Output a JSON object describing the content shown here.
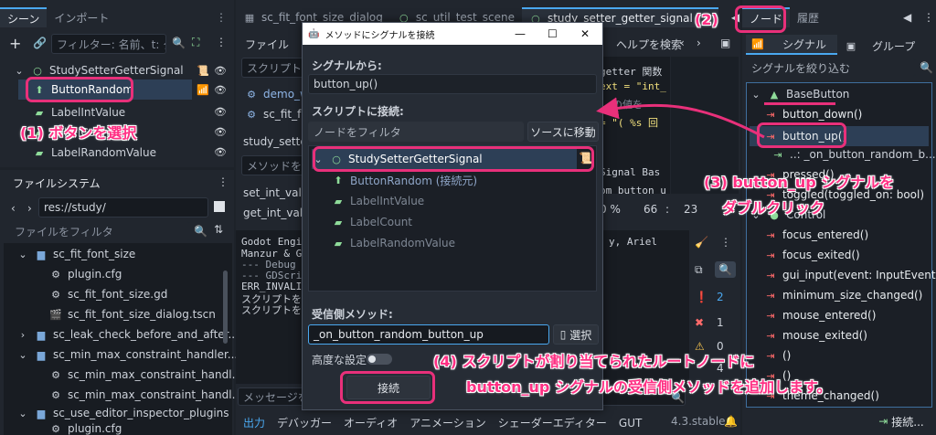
{
  "scene_dock": {
    "tabs": [
      "シーン",
      "インポート"
    ],
    "filter_placeholder": "フィルター: 名前、t: タ",
    "nodes": [
      {
        "label": "StudySetterGetterSignal"
      },
      {
        "label": "ButtonRandom"
      },
      {
        "label": "LabelIntValue"
      },
      {
        "label": "LabelCount"
      },
      {
        "label": "LabelRandomValue"
      }
    ]
  },
  "filesystem": {
    "title": "ファイルシステム",
    "path": "res://study/",
    "filter_placeholder": "ファイルをフィルタ",
    "items": [
      {
        "label": "sc_fit_font_size",
        "icon": "folder-icon"
      },
      {
        "label": "plugin.cfg",
        "icon": "gear-icon"
      },
      {
        "label": "sc_fit_font_size.gd",
        "icon": "gear-icon"
      },
      {
        "label": "sc_fit_font_size_dialog.tscn",
        "icon": "scene-icon"
      },
      {
        "label": "sc_leak_check_before_and_after...",
        "icon": "folder-icon"
      },
      {
        "label": "sc_min_max_constraint_handler...",
        "icon": "folder-icon"
      },
      {
        "label": "sc_min_max_constraint_handl...",
        "icon": "gear-icon"
      },
      {
        "label": "sc_min_max_constraint_handl...",
        "icon": "gear-icon"
      },
      {
        "label": "sc_use_editor_inspector_plugins",
        "icon": "folder-icon"
      },
      {
        "label": "plugin.cfg",
        "icon": "gear-icon"
      }
    ]
  },
  "editor_tabs": [
    "sc_fit_font_size_dialog",
    "sc_util_test_scene",
    "study_setter_getter_signal"
  ],
  "script_editor": {
    "menu_file": "ファイル",
    "scripts_filter": "スクリプトを",
    "script_list": [
      "demo_w",
      "sc_fit_for"
    ],
    "method_header": "study_setter",
    "method_filter": "メソッドを絞",
    "methods": [
      "set_int_value",
      "get_int_value"
    ],
    "help_search": "ヘルプを検索",
    "code_lines": [
      "getter 関数",
      "ext = \"int_",
      "の値を",
      "= \"( %s 回",
      "Signal Bas",
      "om button u"
    ],
    "zoom": "0 %",
    "line": "66",
    "col": "23",
    "output_lines": [
      "Godot Engin",
      "Manzur & Ge",
      "--- Debug a",
      "--- GDScrip",
      "ERR_INVALID",
      "スクリプトを",
      "スクリプトを"
    ],
    "output_right": [
      "y, Ariel"
    ],
    "message_filter": "メッセージを",
    "badges": [
      "2",
      "1",
      "0",
      "4"
    ],
    "bottom_tabs": [
      "出力",
      "デバッガー",
      "オーディオ",
      "アニメーション",
      "シェーダーエディター",
      "GUT"
    ],
    "version": "4.3.stable"
  },
  "dialog": {
    "title": "メソッドにシグナルを接続",
    "from_label": "シグナルから:",
    "from_value": "button_up()",
    "to_label": "スクリプトに接続:",
    "node_filter": "ノードをフィルタ",
    "goto_source": "ソースに移動",
    "tree": [
      {
        "label": "StudySetterGetterSignal"
      },
      {
        "label": "ButtonRandom (接続元)"
      },
      {
        "label": "LabelIntValue"
      },
      {
        "label": "LabelCount"
      },
      {
        "label": "LabelRandomValue"
      }
    ],
    "receiver_label": "受信側メソッド:",
    "receiver_value": "_on_button_random_button_up",
    "pick": "選択",
    "advanced": "高度な設定",
    "connect": "接続"
  },
  "node_dock": {
    "tabs": [
      "ノード",
      "履歴"
    ],
    "subtabs": [
      "シグナル",
      "グループ"
    ],
    "filter_placeholder": "シグナルを絞り込む",
    "class_base": "BaseButton",
    "signals_base": [
      "button_down()",
      "button_up()"
    ],
    "connection": "..: _on_button_random_b...",
    "signals_more": [
      "pressed()",
      "toggled(toggled_on: bool)"
    ],
    "class_control": "Control",
    "signals_control": [
      "focus_entered()",
      "focus_exited()",
      "gui_input(event: InputEvent)",
      "minimum_size_changed()",
      "mouse_entered()",
      "mouse_exited()",
      "()",
      "()",
      "theme_changed()"
    ],
    "connect_button": "接続..."
  },
  "annotations": {
    "a1": "(1) ボタンを選択",
    "a2": "(2)",
    "a3_line1": "(3) button_up シグナルを",
    "a3_line2": "ダブルクリック",
    "a4_line1": "(4) スクリプトが割り当てられたルートノードに",
    "a4_line2": "button_up シグナルの受信側メソッドを追加します。"
  },
  "colors": {
    "accent": "#4aa8ef",
    "annotation": "#ff2f83",
    "signal_red": "#ff6a6a",
    "node_green": "#8fdc9a"
  }
}
